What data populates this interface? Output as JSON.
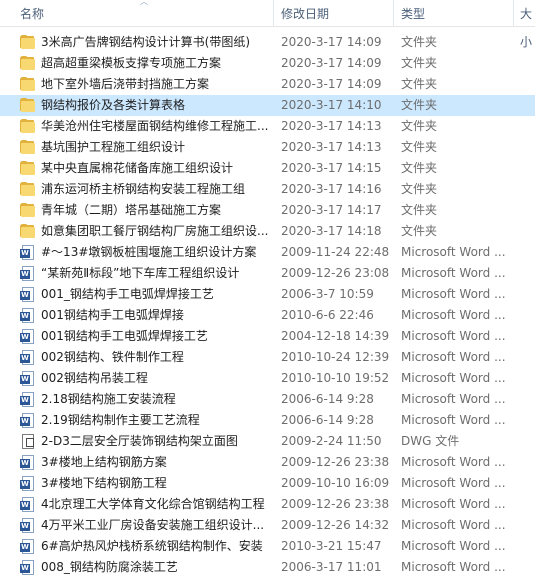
{
  "columns": {
    "name": "名称",
    "date": "修改日期",
    "type": "类型",
    "size": "大小"
  },
  "files": [
    {
      "name": "3米高广告牌钢结构设计计算书(带图纸)",
      "date": "2020-3-17 14:09",
      "type": "文件夹",
      "icon": "folder-icon"
    },
    {
      "name": "超高超重梁模板支撑专项施工方案",
      "date": "2020-3-17 14:09",
      "type": "文件夹",
      "icon": "folder-icon"
    },
    {
      "name": "地下室外墙后浇带封挡施工方案",
      "date": "2020-3-17 14:09",
      "type": "文件夹",
      "icon": "folder-icon"
    },
    {
      "name": "钢结构报价及各类计算表格",
      "date": "2020-3-17 14:10",
      "type": "文件夹",
      "icon": "folder-icon",
      "selected": true
    },
    {
      "name": "华美沧州住宅楼屋面钢结构维修工程施工...",
      "date": "2020-3-17 14:13",
      "type": "文件夹",
      "icon": "folder-icon"
    },
    {
      "name": "基坑围护工程施工组织设计",
      "date": "2020-3-17 14:13",
      "type": "文件夹",
      "icon": "folder-icon"
    },
    {
      "name": "某中央直属棉花储备库施工组织设计",
      "date": "2020-3-17 14:15",
      "type": "文件夹",
      "icon": "folder-icon"
    },
    {
      "name": "浦东运河桥主桥钢结构安装工程施工组",
      "date": "2020-3-17 14:16",
      "type": "文件夹",
      "icon": "folder-icon"
    },
    {
      "name": "青年城（二期）塔吊基础施工方案",
      "date": "2020-3-17 14:17",
      "type": "文件夹",
      "icon": "folder-icon"
    },
    {
      "name": "如意集团职工餐厅钢结构厂房施工组织设...",
      "date": "2020-3-17 14:18",
      "type": "文件夹",
      "icon": "folder-icon"
    },
    {
      "name": "#～13#墩钢板桩围堰施工组织设计方案",
      "date": "2009-11-24 22:48",
      "type": "Microsoft Word ...",
      "icon": "word-doc-icon"
    },
    {
      "name": "“某新苑Ⅱ标段”地下车库工程组织设计",
      "date": "2009-12-26 23:08",
      "type": "Microsoft Word ...",
      "icon": "word-doc-icon"
    },
    {
      "name": "001_钢结构手工电弧焊焊接工艺",
      "date": "2006-3-7 10:59",
      "type": "Microsoft Word ...",
      "icon": "word-doc-icon"
    },
    {
      "name": "001钢结构手工电弧焊焊接",
      "date": "2010-6-6 22:46",
      "type": "Microsoft Word ...",
      "icon": "word-doc-icon"
    },
    {
      "name": "001钢结构手工电弧焊焊接工艺",
      "date": "2004-12-18 14:39",
      "type": "Microsoft Word ...",
      "icon": "word-doc-icon"
    },
    {
      "name": "002钢结构、铁件制作工程",
      "date": "2010-10-24 12:39",
      "type": "Microsoft Word ...",
      "icon": "word-doc-icon"
    },
    {
      "name": "002钢结构吊装工程",
      "date": "2010-10-10 19:52",
      "type": "Microsoft Word ...",
      "icon": "word-doc-icon"
    },
    {
      "name": "2.18钢结构施工安装流程",
      "date": "2006-6-14 9:28",
      "type": "Microsoft Word ...",
      "icon": "word-doc-icon"
    },
    {
      "name": "2.19钢结构制作主要工艺流程",
      "date": "2006-6-14 9:28",
      "type": "Microsoft Word ...",
      "icon": "word-doc-icon"
    },
    {
      "name": "2-D3二层安全厅装饰钢结构架立面图",
      "date": "2009-2-24 11:50",
      "type": "DWG 文件",
      "icon": "dwg-file-icon"
    },
    {
      "name": "3#楼地上结构钢筋方案",
      "date": "2009-12-26 23:38",
      "type": "Microsoft Word ...",
      "icon": "word-doc-icon"
    },
    {
      "name": "3#楼地下结构钢筋工程",
      "date": "2009-10-10 16:09",
      "type": "Microsoft Word ...",
      "icon": "word-doc-icon"
    },
    {
      "name": "4北京理工大学体育文化综合馆钢结构工程",
      "date": "2009-12-26 23:38",
      "type": "Microsoft Word ...",
      "icon": "word-doc-icon"
    },
    {
      "name": "4万平米工业厂房设备安装施工组织设计...",
      "date": "2009-12-26 14:32",
      "type": "Microsoft Word ...",
      "icon": "word-doc-icon"
    },
    {
      "name": "6#高炉热风炉栈桥系统钢结构制作、安装",
      "date": "2010-3-21 15:47",
      "type": "Microsoft Word ...",
      "icon": "word-doc-icon"
    },
    {
      "name": "008_钢结构防腐涂装工艺",
      "date": "2006-3-17 11:01",
      "type": "Microsoft Word ...",
      "icon": "word-doc-icon"
    }
  ],
  "colors": {
    "selected_row": "#cce8ff",
    "header_text": "#4c607a",
    "folder": "#f8d870",
    "word_badge": "#2b5797"
  }
}
